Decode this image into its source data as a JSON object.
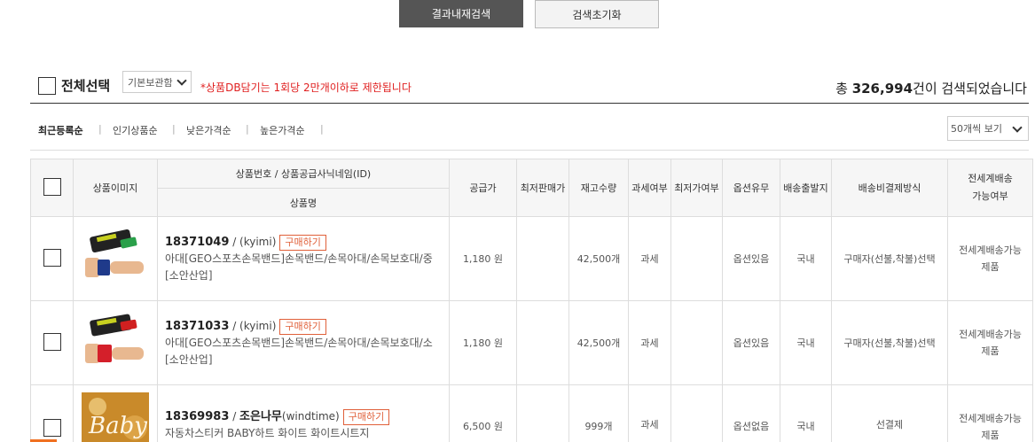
{
  "actions": {
    "search_within": "결과내재검색",
    "reset_search": "검색초기화"
  },
  "selection": {
    "select_all": "전체선택",
    "sort_default": "기본보관함",
    "limit_note": "*상품DB담기는 1회당 2만개이하로 제한됩니다",
    "total_prefix": "총 ",
    "total_count": "326,994",
    "total_suffix": "건이 검색되었습니다"
  },
  "sort_options": [
    "최근등록순",
    "인기상품순",
    "낮은가격순",
    "높은가격순"
  ],
  "per_page": "50개씩 보기",
  "table": {
    "headers": {
      "image": "상품이미지",
      "id_seller": "상품번호 / 상품공급사닉네임(ID)",
      "name": "상품명",
      "supply_price": "공급가",
      "min_price": "최저판매가",
      "stock": "재고수량",
      "tax": "과세여부",
      "min_fixed": "최저가여부",
      "option": "옵션유무",
      "origin": "배송출발지",
      "shipping_pay": "배송비결제방식",
      "global_line1": "전세계배송",
      "global_line2": "가능여부"
    },
    "rows": [
      {
        "id": "18371049",
        "sep": " / ",
        "seller": "(kyimi)",
        "buy": "구매하기",
        "name": "아대[GEO스포츠손목밴드]손목밴드/손목아대/손목보호대/중[소안산업]",
        "price": "1,180 원",
        "min_price": "",
        "stock": "42,500개",
        "tax": "과세",
        "min_fixed": "",
        "option": "옵션있음",
        "origin": "국내",
        "shipping": "구매자(선불,착불)선택",
        "global": "전세계배송가능제품"
      },
      {
        "id": "18371033",
        "sep": " / ",
        "seller": "(kyimi)",
        "buy": "구매하기",
        "name": "아대[GEO스포츠손목밴드]손목밴드/손목아대/손목보호대/소[소안산업]",
        "price": "1,180 원",
        "min_price": "",
        "stock": "42,500개",
        "tax": "과세",
        "min_fixed": "",
        "option": "옵션있음",
        "origin": "국내",
        "shipping": "구매자(선불,착불)선택",
        "global": "전세계배송가능제품"
      },
      {
        "id": "18369983",
        "sep": " / ",
        "seller_bold": "조은나무",
        "seller": "(windtime)",
        "buy": "구매하기",
        "name": "자동차스티커 BABY하트 화이트 화이트시트지",
        "price": "6,500 원",
        "min_price": "",
        "stock": "999개",
        "tax": "과세",
        "min_fixed": "",
        "option": "옵션없음",
        "origin": "국내",
        "shipping": "선결제",
        "global": "전세계배송가능제품"
      }
    ]
  }
}
